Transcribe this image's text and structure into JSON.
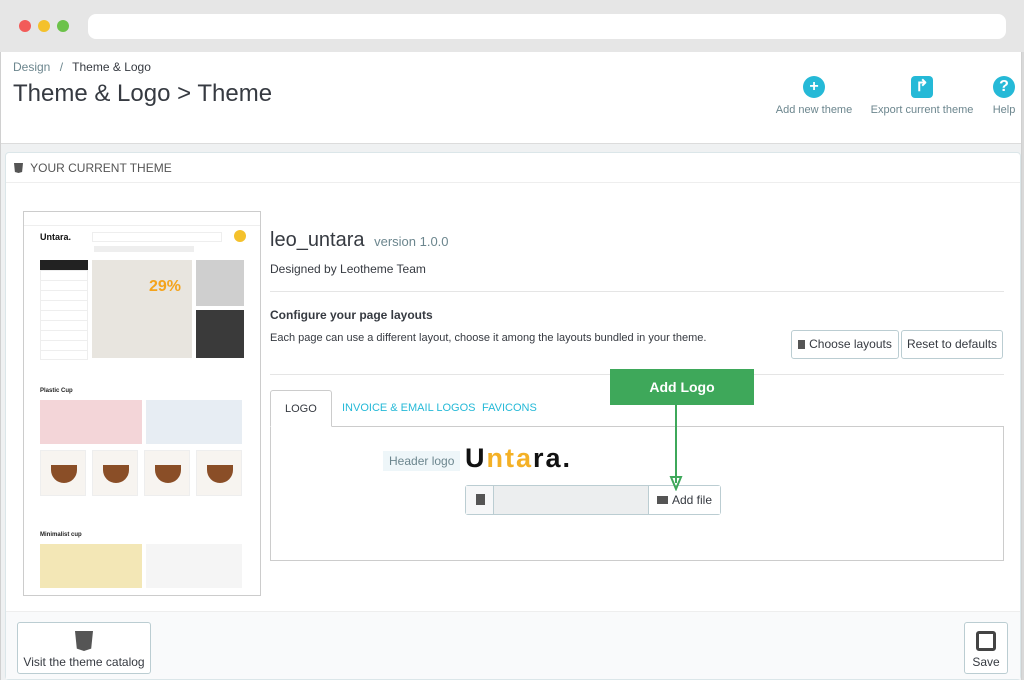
{
  "breadcrumb": {
    "parent": "Design",
    "separator": "/",
    "current": "Theme & Logo"
  },
  "page_title": "Theme & Logo > Theme",
  "toolbar": {
    "add_theme_label": "Add new theme",
    "export_theme_label": "Export current theme",
    "help_label": "Help",
    "add_icon": "plus-circle-icon",
    "export_icon": "share-icon",
    "help_icon": "question-circle-icon",
    "icon_color": "#25b9d7"
  },
  "panel": {
    "heading": "YOUR CURRENT THEME"
  },
  "preview": {
    "logo": "Untara.",
    "hero_offer": "29%",
    "section1": "Plastic Cup",
    "section2": "Minimalist cup"
  },
  "theme": {
    "name": "leo_untara",
    "version": "version 1.0.0",
    "designer": "Designed by Leotheme Team"
  },
  "layouts": {
    "title": "Configure your page layouts",
    "description": "Each page can use a different layout, choose it among the layouts bundled in your theme.",
    "choose_label": "Choose layouts",
    "reset_label": "Reset to defaults"
  },
  "tabs": [
    {
      "label": "LOGO",
      "active": true
    },
    {
      "label": "INVOICE & EMAIL LOGOS",
      "active": false
    },
    {
      "label": "FAVICONS",
      "active": false
    }
  ],
  "logo_tab": {
    "header_logo_label": "Header logo",
    "logo_text_a": "U",
    "logo_text_b": "nta",
    "logo_text_c": "ra.",
    "add_file_label": "Add file",
    "file_value": ""
  },
  "callout": {
    "label": "Add Logo",
    "color": "#3ea85a"
  },
  "footer": {
    "catalog_label": "Visit the theme catalog",
    "save_label": "Save"
  }
}
